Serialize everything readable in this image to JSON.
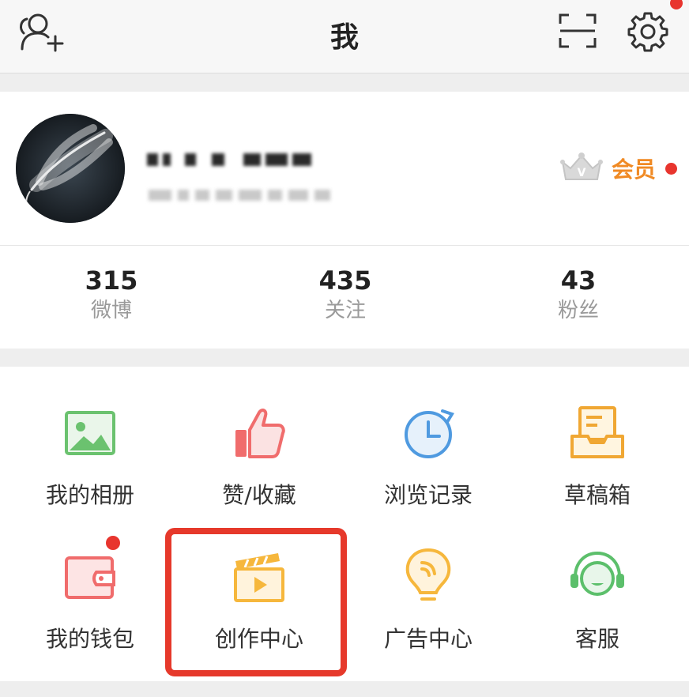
{
  "nav": {
    "title": "我",
    "icons": [
      "add-friend-icon",
      "scan-icon",
      "settings-icon"
    ]
  },
  "profile": {
    "membership": {
      "label": "会员",
      "icon": "vip-crown-icon"
    }
  },
  "stats": [
    {
      "value": "315",
      "label": "微博"
    },
    {
      "value": "435",
      "label": "关注"
    },
    {
      "value": "43",
      "label": "粉丝"
    }
  ],
  "menu": [
    {
      "label": "我的相册",
      "icon": "photo-album-icon"
    },
    {
      "label": "赞/收藏",
      "icon": "thumbs-up-icon"
    },
    {
      "label": "浏览记录",
      "icon": "history-clock-icon"
    },
    {
      "label": "草稿箱",
      "icon": "draft-box-icon"
    },
    {
      "label": "我的钱包",
      "icon": "wallet-icon"
    },
    {
      "label": "创作中心",
      "icon": "clapperboard-icon"
    },
    {
      "label": "广告中心",
      "icon": "ad-bulb-icon"
    },
    {
      "label": "客服",
      "icon": "headset-icon"
    }
  ],
  "colors": {
    "accent_red": "#e8352e",
    "vip_orange": "#f08a24",
    "highlight_box": "#e6392b"
  }
}
